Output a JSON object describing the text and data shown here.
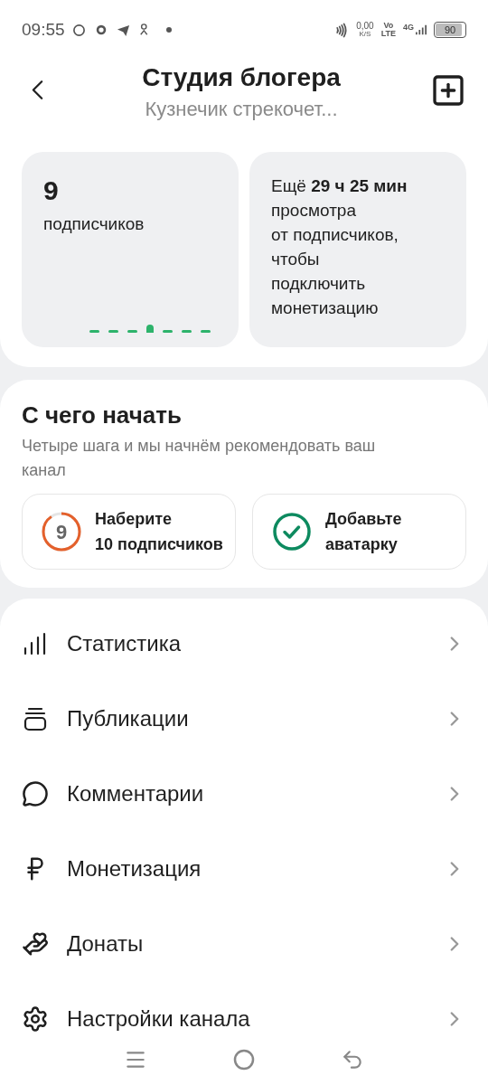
{
  "status_bar": {
    "time": "09:55",
    "speed": "0,00",
    "speed_unit": "K/S",
    "volte_top": "Vo",
    "volte_bottom": "LTE",
    "network": "4G",
    "battery": "90"
  },
  "header": {
    "title": "Студия блогера",
    "subtitle": "Кузнечик стрекочет..."
  },
  "stats": {
    "count": "9",
    "count_label": "подписчиков",
    "pager": [
      {
        "selected": false
      },
      {
        "selected": false
      },
      {
        "selected": false
      },
      {
        "selected": true
      },
      {
        "selected": false
      },
      {
        "selected": false
      },
      {
        "selected": false
      }
    ],
    "monetization_text": "Ещё **29 ч 25 мин** просмотра\nот подписчиков,\nчтобы\nподключить\nмонетизацию"
  },
  "getting_started": {
    "title": "С чего начать",
    "description": "Четыре шага и мы начнём рекомендовать ваш канал",
    "steps": [
      {
        "kind": "progress",
        "value": "9",
        "label": "Наберите\n10 подписчиков"
      },
      {
        "kind": "done",
        "label": "Добавьте\nаватарку"
      }
    ]
  },
  "menu": [
    {
      "label": "Статистика"
    },
    {
      "label": "Публикации"
    },
    {
      "label": "Комментарии"
    },
    {
      "label": "Монетизация"
    },
    {
      "label": "Донаты"
    },
    {
      "label": "Настройки канала"
    }
  ]
}
